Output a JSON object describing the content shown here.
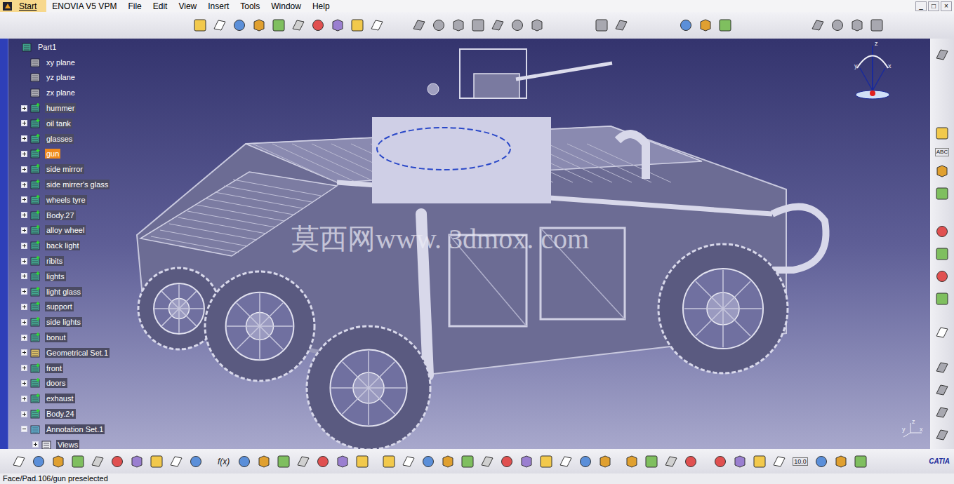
{
  "menu": {
    "start": "Start",
    "items": [
      "ENOVIA V5 VPM",
      "File",
      "Edit",
      "View",
      "Insert",
      "Tools",
      "Window",
      "Help"
    ]
  },
  "window_controls": [
    "_",
    "□",
    "×"
  ],
  "tree": [
    {
      "label": "Part1",
      "kind": "part",
      "expanded": true,
      "selected": false
    },
    {
      "label": "xy plane",
      "kind": "plane",
      "expanded": false,
      "selected": false
    },
    {
      "label": "yz plane",
      "kind": "plane",
      "expanded": false,
      "selected": false
    },
    {
      "label": "zx plane",
      "kind": "plane",
      "expanded": false,
      "selected": false
    },
    {
      "label": "hummer",
      "kind": "body",
      "expanded": false,
      "selected": false
    },
    {
      "label": "oil tank",
      "kind": "body",
      "expanded": false,
      "selected": false
    },
    {
      "label": "glasses",
      "kind": "body",
      "expanded": false,
      "selected": false
    },
    {
      "label": "gun",
      "kind": "body",
      "expanded": false,
      "selected": true
    },
    {
      "label": "side mirror",
      "kind": "body",
      "expanded": false,
      "selected": false
    },
    {
      "label": "side mirrer's glass",
      "kind": "body",
      "expanded": false,
      "selected": false
    },
    {
      "label": "wheels tyre",
      "kind": "body",
      "expanded": false,
      "selected": false
    },
    {
      "label": "Body.27",
      "kind": "body",
      "expanded": false,
      "selected": false
    },
    {
      "label": "alloy wheel",
      "kind": "body",
      "expanded": false,
      "selected": false
    },
    {
      "label": "back light",
      "kind": "body",
      "expanded": false,
      "selected": false
    },
    {
      "label": "ribits",
      "kind": "body",
      "expanded": false,
      "selected": false
    },
    {
      "label": "lights",
      "kind": "body",
      "expanded": false,
      "selected": false
    },
    {
      "label": "light glass",
      "kind": "body",
      "expanded": false,
      "selected": false
    },
    {
      "label": "support",
      "kind": "body",
      "expanded": false,
      "selected": false
    },
    {
      "label": "side lights",
      "kind": "body",
      "expanded": false,
      "selected": false
    },
    {
      "label": "bonut",
      "kind": "body",
      "expanded": false,
      "selected": false
    },
    {
      "label": "Geometrical Set.1",
      "kind": "geoset",
      "expanded": false,
      "selected": false
    },
    {
      "label": "front",
      "kind": "body",
      "expanded": false,
      "selected": false
    },
    {
      "label": "doors",
      "kind": "body",
      "expanded": false,
      "selected": false
    },
    {
      "label": "exhaust",
      "kind": "body",
      "expanded": false,
      "selected": false
    },
    {
      "label": "Body.24",
      "kind": "body",
      "expanded": false,
      "selected": false
    },
    {
      "label": "Annotation Set.1",
      "kind": "annotation",
      "expanded": true,
      "selected": false
    },
    {
      "label": "Views",
      "kind": "views",
      "expanded": false,
      "selected": false
    }
  ],
  "viewport": {
    "watermark": "莫西网www. 3dmox. com",
    "compass": [
      "z",
      "y",
      "x"
    ],
    "axis": [
      "y",
      "z",
      "x"
    ]
  },
  "toolbar_labels": {
    "formula": "f(x)",
    "measure": "10.0",
    "text": "ABC"
  },
  "logo": "CATIA",
  "status": "Face/Pad.106/gun preselected"
}
